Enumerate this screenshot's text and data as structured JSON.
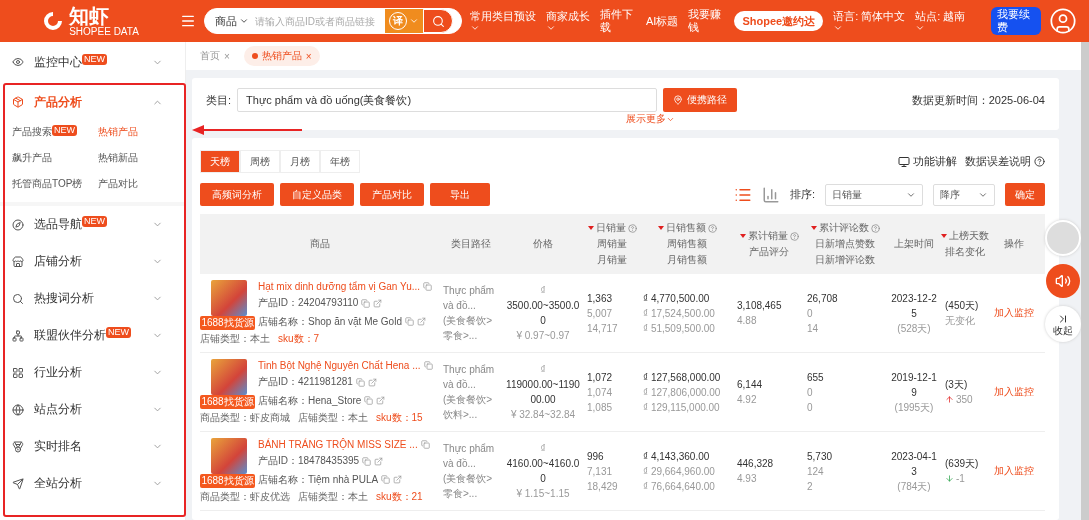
{
  "header": {
    "logo": "知虾",
    "logo_sub": "SHOPEE DATA",
    "search": {
      "scope": "商品",
      "placeholder": "请输入商品ID或者商品链接",
      "translate": "译"
    },
    "nav": [
      {
        "label": "常用类目预设",
        "kind": "dropdown"
      },
      {
        "label": "商家成长",
        "kind": "dropdown"
      },
      {
        "label": "插件下载",
        "kind": "link"
      },
      {
        "label": "AI标题",
        "kind": "link"
      },
      {
        "label": "我要赚钱",
        "kind": "link"
      },
      {
        "label": "Shopee邀约达",
        "kind": "pill"
      },
      {
        "label": "语言: 简体中文",
        "kind": "dropdown"
      },
      {
        "label": "站点: 越南",
        "kind": "dropdown"
      },
      {
        "label": "我要续费",
        "kind": "renew"
      }
    ]
  },
  "sidebar": {
    "items": [
      {
        "label": "监控中心",
        "badge": "NEW",
        "expanded": false,
        "selected": false
      },
      {
        "label": "产品分析",
        "expanded": true,
        "selected": true,
        "children": [
          {
            "label": "产品搜索",
            "badge": "NEW",
            "selected": false
          },
          {
            "label": "热销产品",
            "selected": true
          },
          {
            "label": "飙升产品",
            "selected": false
          },
          {
            "label": "热销新品",
            "selected": false
          },
          {
            "label": "托管商品TOP榜",
            "selected": false
          },
          {
            "label": "产品对比",
            "selected": false
          }
        ]
      },
      {
        "label": "选品导航",
        "badge": "NEW",
        "expanded": false,
        "selected": false
      },
      {
        "label": "店铺分析",
        "expanded": false,
        "selected": false
      },
      {
        "label": "热搜词分析",
        "expanded": false,
        "selected": false
      },
      {
        "label": "联盟伙伴分析",
        "badge": "NEW",
        "expanded": false,
        "selected": false
      },
      {
        "label": "行业分析",
        "expanded": false,
        "selected": false
      },
      {
        "label": "站点分析",
        "expanded": false,
        "selected": false
      },
      {
        "label": "实时排名",
        "expanded": false,
        "selected": false
      },
      {
        "label": "全站分析",
        "expanded": false,
        "selected": false
      }
    ]
  },
  "breadcrumbs": [
    {
      "label": "首页",
      "close": "×",
      "selected": false
    },
    {
      "label": "热销产品",
      "close": "×",
      "selected": true
    }
  ],
  "filter": {
    "label": "类目:",
    "value": "Thực phẩm và đồ uống(美食餐饮)",
    "path_button": "便携路径",
    "more": "展示更多",
    "updated": "数据更新时间：2025-06-04"
  },
  "period_tabs": [
    {
      "label": "天榜",
      "selected": true
    },
    {
      "label": "周榜",
      "selected": false
    },
    {
      "label": "月榜",
      "selected": false
    },
    {
      "label": "年榜",
      "selected": false
    }
  ],
  "actions": [
    "高频词分析",
    "自定义品类",
    "产品对比",
    "导出"
  ],
  "help_links": [
    "功能讲解",
    "数据误差说明"
  ],
  "view_toggle": [
    {
      "kind": "list",
      "selected": true
    },
    {
      "kind": "chart",
      "selected": false
    }
  ],
  "sort": {
    "label": "排序:",
    "field": "日销量",
    "order": "降序",
    "confirm": "确定"
  },
  "table": {
    "columns": [
      {
        "lines": [
          "商品"
        ],
        "sortable": false,
        "help": false
      },
      {
        "lines": [
          "类目路径"
        ],
        "sortable": false,
        "help": false
      },
      {
        "lines": [
          "价格"
        ],
        "sortable": false,
        "help": false
      },
      {
        "lines": [
          "日销量",
          "周销量",
          "月销量"
        ],
        "sortable": true,
        "help": true
      },
      {
        "lines": [
          "日销售额",
          "周销售额",
          "月销售额"
        ],
        "sortable": true,
        "help": true
      },
      {
        "lines": [
          "累计销量",
          "产品评分"
        ],
        "sortable": true,
        "help": true
      },
      {
        "lines": [
          "累计评论数",
          "日新增点赞数",
          "日新增评论数"
        ],
        "sortable": true,
        "help": true
      },
      {
        "lines": [
          "上架时间"
        ],
        "sortable": false,
        "help": false
      },
      {
        "lines": [
          "上榜天数",
          "排名变化"
        ],
        "sortable": true,
        "help": false
      },
      {
        "lines": [
          "操作"
        ],
        "sortable": false,
        "help": false
      }
    ],
    "rows": [
      {
        "title": "Hạt mix dinh dưỡng tẩm vị Gan Yu...",
        "id": "产品ID：24204793110",
        "shop": "店铺名称：Shop ăn vặt Me Gold",
        "source": "1688找货源",
        "meta": [
          {
            "text": "店铺类型：本土",
            "kind": "plain"
          },
          {
            "text": "sku数：7",
            "kind": "accent"
          }
        ],
        "category": [
          "Thực phẩm và đồ...",
          "(美食餐饮>零食>..."
        ],
        "currency": "₫",
        "price": "3500.00~3500.00",
        "price_cny": "¥ 0.97~0.97",
        "sales": [
          "1,363",
          "5,007",
          "14,717"
        ],
        "revenue": [
          "₫ 4,770,500.00",
          "₫ 17,524,500.00",
          "₫ 51,509,500.00"
        ],
        "total": "3,108,465",
        "rating": "4.88",
        "reviews": [
          "26,708",
          "0",
          "14"
        ],
        "listed": "2023-12-25",
        "listed_age": "(528天)",
        "days": "(450天)",
        "change": {
          "kind": "none",
          "text": "无变化"
        },
        "action": "加入监控"
      },
      {
        "title": "Tinh Bột Nghệ Nguyên Chất Hena ...",
        "id": "产品ID：4211981281",
        "shop": "店铺名称：Hena_Store",
        "source": "1688找货源",
        "meta": [
          {
            "text": "商品类型：虾皮商城",
            "kind": "plain"
          },
          {
            "text": "店铺类型：本土",
            "kind": "plain"
          },
          {
            "text": "sku数：15",
            "kind": "accent"
          }
        ],
        "category": [
          "Thực phẩm và đồ...",
          "(美食餐饮>饮料>..."
        ],
        "currency": "₫",
        "price": "119000.00~119000.00",
        "price_cny": "¥ 32.84~32.84",
        "sales": [
          "1,072",
          "1,074",
          "1,085"
        ],
        "revenue": [
          "₫ 127,568,000.00",
          "₫ 127,806,000.00",
          "₫ 129,115,000.00"
        ],
        "total": "6,144",
        "rating": "4.92",
        "reviews": [
          "655",
          "0",
          "0"
        ],
        "listed": "2019-12-19",
        "listed_age": "(1995天)",
        "days": "(3天)",
        "change": {
          "kind": "up",
          "text": "350"
        },
        "action": "加入监控"
      },
      {
        "title": "BÁNH TRÁNG TRỘN MISS SIZE ...",
        "id": "产品ID：18478435395",
        "shop": "店铺名称：Tiệm nhà PULA",
        "source": "1688找货源",
        "meta": [
          {
            "text": "商品类型：虾皮优选",
            "kind": "plain"
          },
          {
            "text": "店铺类型：本土",
            "kind": "plain"
          },
          {
            "text": "sku数：21",
            "kind": "accent"
          }
        ],
        "category": [
          "Thực phẩm và đồ...",
          "(美食餐饮>零食>..."
        ],
        "currency": "₫",
        "price": "4160.00~4160.00",
        "price_cny": "¥ 1.15~1.15",
        "sales": [
          "996",
          "7,131",
          "18,429"
        ],
        "revenue": [
          "₫ 4,143,360.00",
          "₫ 29,664,960.00",
          "₫ 76,664,640.00"
        ],
        "total": "446,328",
        "rating": "4.93",
        "reviews": [
          "5,730",
          "124",
          "2"
        ],
        "listed": "2023-04-13",
        "listed_age": "(784天)",
        "days": "(639天)",
        "change": {
          "kind": "down",
          "text": "-1"
        },
        "action": "加入监控"
      }
    ]
  },
  "float_tools": {
    "collapse": "收起"
  }
}
